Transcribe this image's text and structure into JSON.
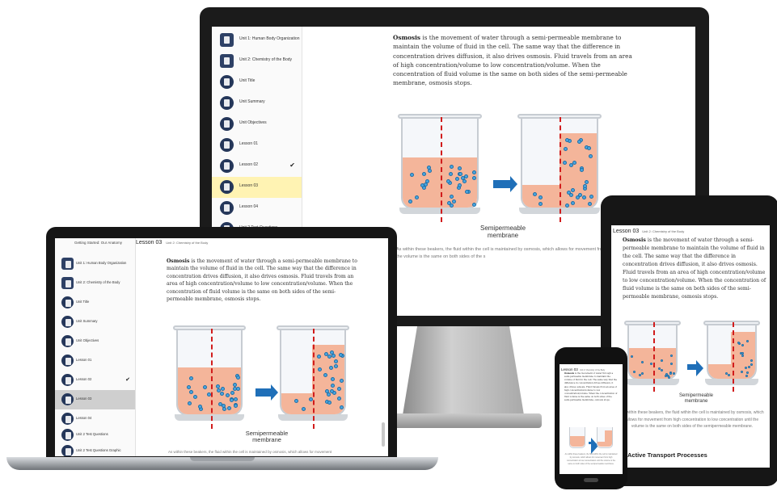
{
  "sidebar": {
    "course_title": "Getting Started: Our Anatomy",
    "items": [
      {
        "label": "Unit 1: Human Body Organization",
        "icon": "folder-icon"
      },
      {
        "label": "Unit 2: Chemistry of the Body",
        "icon": "folder-open-icon"
      },
      {
        "label": "Unit Title",
        "icon": "document-icon"
      },
      {
        "label": "Unit Summary",
        "icon": "document-icon"
      },
      {
        "label": "Unit Objectives",
        "icon": "document-icon"
      },
      {
        "label": "Lesson 01",
        "icon": "document-icon"
      },
      {
        "label": "Lesson 02",
        "icon": "document-icon",
        "check": "✔"
      },
      {
        "label": "Lesson 03",
        "icon": "document-icon"
      },
      {
        "label": "Lesson 04",
        "icon": "document-icon"
      },
      {
        "label": "Unit 2 Test Questions",
        "icon": "document-icon"
      },
      {
        "label": "Unit 2 Test Questions Graphic",
        "icon": "document-icon"
      }
    ]
  },
  "lesson": {
    "title": "Lesson 03",
    "unit": "Unit 2: Chemistry of the Body",
    "term": "Osmosis",
    "body": " is the movement of water through a semi-permeable membrane to maintain the volume of fluid in the cell. The same way that the difference in concentration drives diffusion, it also drives osmosis. Fluid travels from an area of high concentration/volume to low concentration/volume. When the concentration of fluid volume is the same on both sides of the semi-permeable membrane, osmosis stops.",
    "figure_label_line1": "Semipermeable",
    "figure_label_line2": "membrane",
    "caption": "As within these beakers, the fluid within the cell is maintained by osmosis, which allows for movement from high concentration to low concentration until the volume is the same on both sides of the semipermeable membrane.",
    "monitor_caption": "As within these beakers, the fluid within the cell is maintained by osmosis, which allows for movement from high concentration to low concentration until the volume is the same on both sides of the s",
    "laptop_caption": "As within these beakers, the fluid within the cell is maintained by osmosis, which allows for movement",
    "next_heading": "Active Transport Processes"
  },
  "colors": {
    "nav_icon": "#25375a",
    "active_highlight": "#fff3b3",
    "liquid": "#f4b59a",
    "membrane": "#d11c1c",
    "arrow": "#1f6fb8"
  }
}
